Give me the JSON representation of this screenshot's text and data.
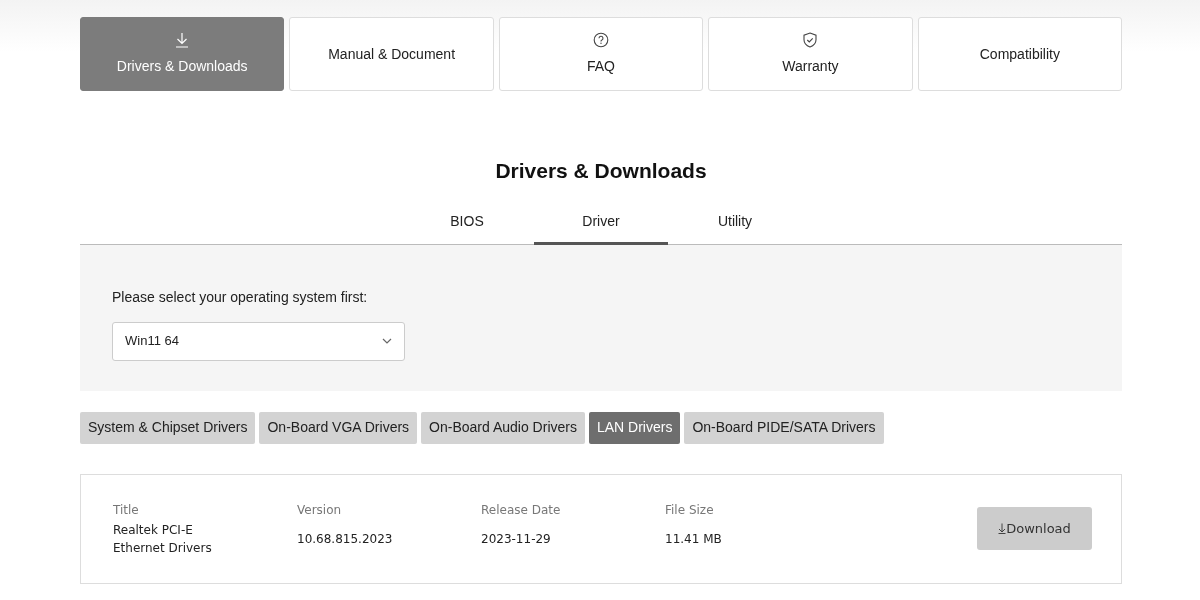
{
  "nav_cards": [
    {
      "label": "Drivers & Downloads",
      "kind": "download",
      "selected": true
    },
    {
      "label": "Manual & Document",
      "kind": "text",
      "selected": false
    },
    {
      "label": "FAQ",
      "kind": "faq",
      "selected": false
    },
    {
      "label": "Warranty",
      "kind": "warranty",
      "selected": false
    },
    {
      "label": "Compatibility",
      "kind": "text",
      "selected": false
    }
  ],
  "heading": "Drivers & Downloads",
  "tabs": [
    {
      "label": "BIOS",
      "selected": false
    },
    {
      "label": "Driver",
      "selected": true
    },
    {
      "label": "Utility",
      "selected": false
    }
  ],
  "os_panel": {
    "label": "Please select your operating system first:",
    "value": "Win11 64"
  },
  "categories": [
    {
      "label": "System & Chipset Drivers",
      "selected": false
    },
    {
      "label": "On-Board VGA Drivers",
      "selected": false
    },
    {
      "label": "On-Board Audio Drivers",
      "selected": false
    },
    {
      "label": "LAN Drivers",
      "selected": true
    },
    {
      "label": "On-Board PIDE/SATA Drivers",
      "selected": false
    }
  ],
  "downloads": [
    {
      "columns": [
        "Title",
        "Version",
        "Release Date",
        "File Size"
      ],
      "values": [
        "Realtek PCI-E Ethernet Drivers",
        "10.68.815.2023",
        "2023-11-29",
        "11.41 MB"
      ],
      "button": "Download"
    }
  ]
}
